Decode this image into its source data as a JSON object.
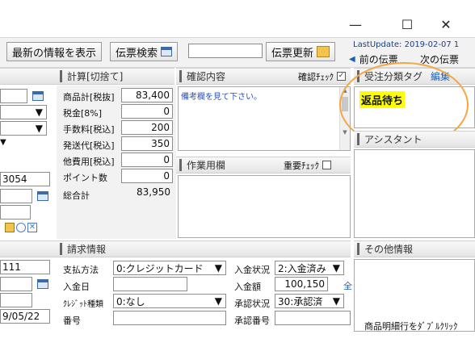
{
  "window": {
    "minimize": "—",
    "maximize": "☐",
    "close": "✕"
  },
  "toolbar": {
    "latest_btn": "最新の情報を表示",
    "search_btn": "伝票検索",
    "update_btn": "伝票更新",
    "last_update": "LastUpdate: 2019-02-07 1",
    "prev_link": "前の伝票",
    "next_link": "次の伝票"
  },
  "calc": {
    "header": "計算[切捨て]",
    "rows": [
      {
        "label": "商品計[税抜]",
        "value": "83,400"
      },
      {
        "label": "税金[8%]",
        "value": "0"
      },
      {
        "label": "手数料[税込]",
        "value": "200"
      },
      {
        "label": "発送代[税込]",
        "value": "350"
      },
      {
        "label": "他費用[税込]",
        "value": "0"
      },
      {
        "label": "ポイント数",
        "value": "0"
      },
      {
        "label": "総合計",
        "value": "83,950"
      }
    ]
  },
  "confirm": {
    "header": "確認内容",
    "check_label": "確認ﾁｪｯｸ",
    "text": "備考欄を見て下さい。"
  },
  "work": {
    "header": "作業用欄",
    "check_label": "重要ﾁｪｯｸ"
  },
  "tags": {
    "header": "受注分類タグ",
    "edit_link": "編集",
    "tag": "返品待ち"
  },
  "assistant": {
    "header": "アシスタント"
  },
  "other": {
    "header": "その他情報",
    "bottom_text": "商品明細行をﾀﾞﾌﾞﾙｸﾘｯｸ"
  },
  "left": {
    "value1": "3054",
    "value2": "111",
    "value3": "9/05/22"
  },
  "payment": {
    "header": "請求情報",
    "method_label": "支払方法",
    "method_value": "0:クレジットカード",
    "date_label": "入金日",
    "card_label": "ｸﾚｼﾞｯﾄ種類",
    "card_value": "0:なし",
    "number_label": "番号",
    "status_label": "入金状況",
    "status_value": "2:入金済み",
    "amount_label": "入金額",
    "amount_value": "100,150",
    "amount_suffix": "全",
    "approval_label": "承認状況",
    "approval_value": "30:承認済",
    "approval_num_label": "承認番号"
  },
  "colors": {
    "tag_bg": "#ffff00",
    "highlight_circle": "#f5a742",
    "link": "#1a5fb4"
  }
}
